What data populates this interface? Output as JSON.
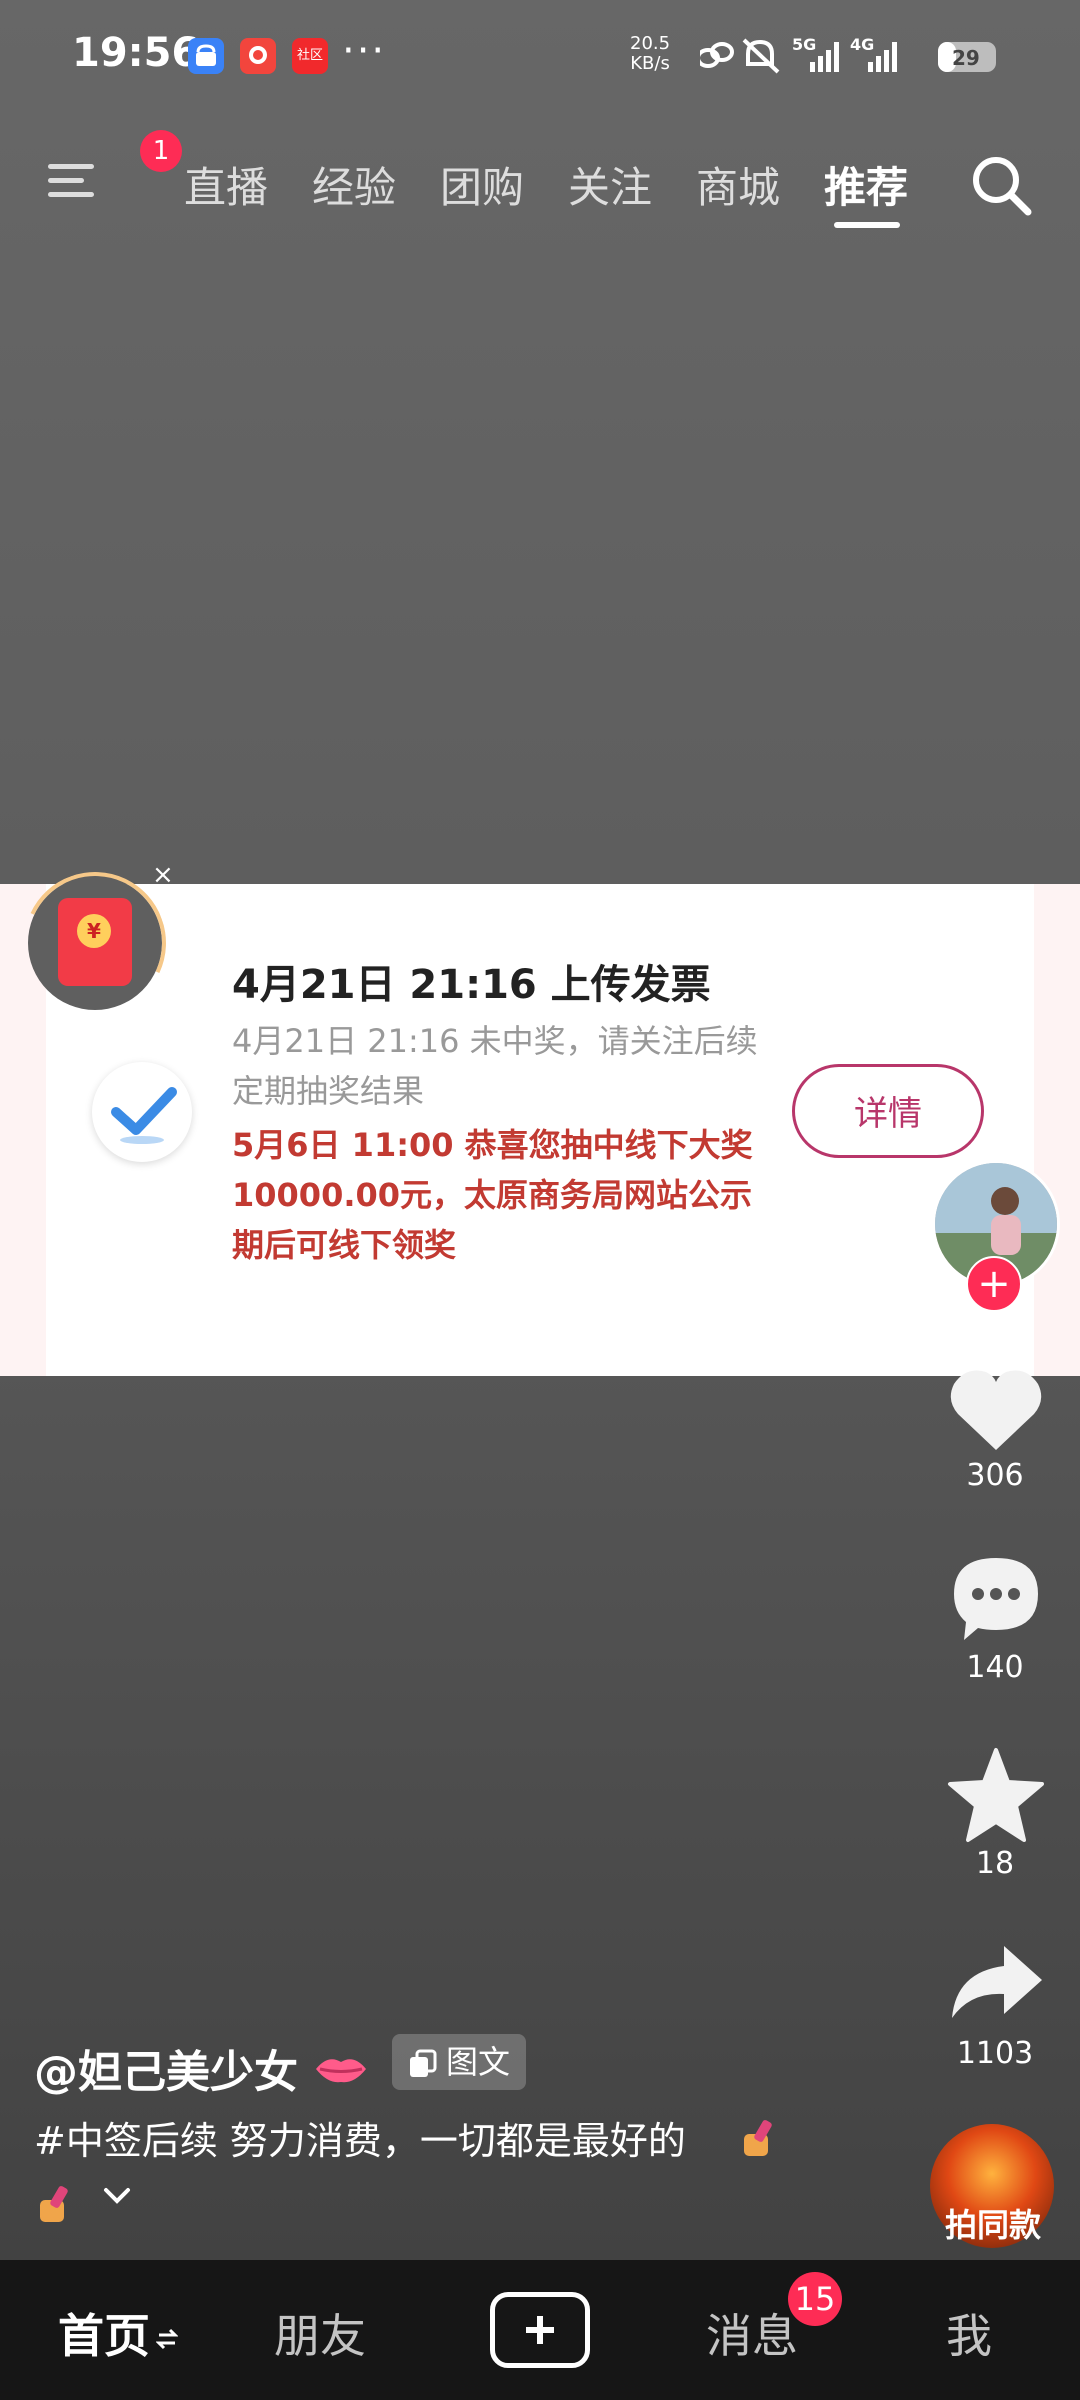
{
  "status_bar": {
    "time": "19:56",
    "speed_value": "20.5",
    "speed_unit": "KB/s",
    "signal1": "5G",
    "signal2": "4G",
    "battery": "29",
    "more": "···"
  },
  "top_nav": {
    "menu_badge": "1",
    "tabs": [
      "直播",
      "经验",
      "团购",
      "关注",
      "商城",
      "推荐"
    ],
    "active_tab": "推荐"
  },
  "card": {
    "title": "4月21日 21:16 上传发票",
    "line2": "4月21日 21:16 未中奖，请关注后续定期抽奖结果",
    "line3": "5月6日 11:00 恭喜您抽中线下大奖10000.00元，太原商务局网站公示期后可线下领奖",
    "detail_button": "详情",
    "close": "×",
    "coin": "¥"
  },
  "actions": {
    "likes": "306",
    "comments": "140",
    "favorites": "18",
    "shares": "1103",
    "same_style": "拍同款",
    "follow": "+"
  },
  "caption": {
    "author": "@妲己美少女",
    "tag": "图文",
    "text": "#中签后续 努力消费，一切都是最好的"
  },
  "bottom_nav": {
    "home": "首页",
    "friends": "朋友",
    "messages": "消息",
    "messages_badge": "15",
    "me": "我"
  },
  "colors": {
    "accent": "#fe2c55",
    "detail": "#b8366a",
    "winning_text": "#c23a32"
  }
}
